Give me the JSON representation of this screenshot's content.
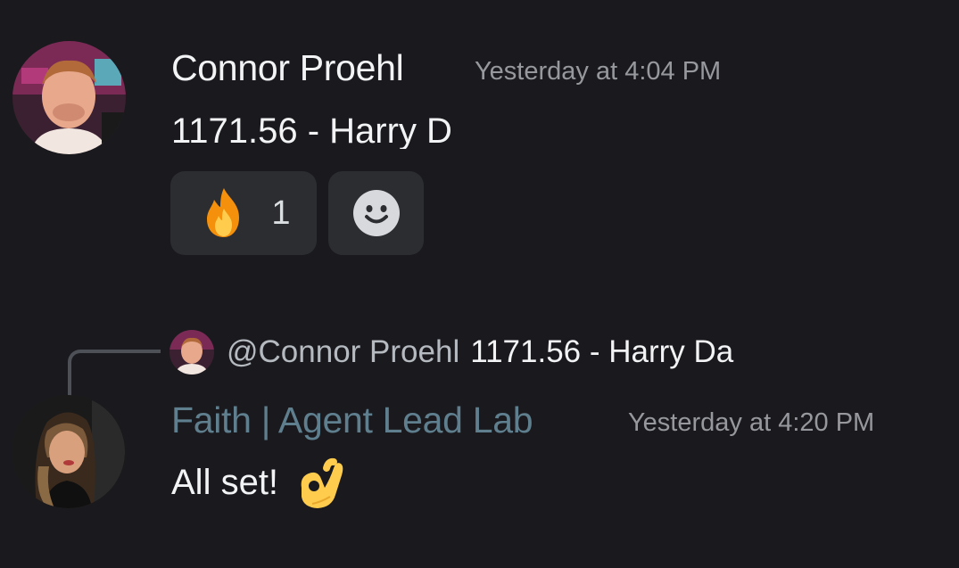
{
  "messages": [
    {
      "author": "Connor Proehl",
      "author_color": "#f2f3f5",
      "timestamp": "Yesterday at 4:04 PM",
      "content": "1171.56 - Harry D",
      "avatar": "avatar-photo-man",
      "reactions": [
        {
          "emoji": "fire-emoji",
          "count": "1"
        },
        {
          "emoji": "add-reaction-smiley-icon"
        }
      ]
    },
    {
      "reply_to": {
        "author": "@Connor Proehl",
        "content": "1171.56 - Harry Da",
        "avatar": "avatar-photo-man"
      },
      "author": "Faith | Agent Lead Lab",
      "author_color": "#5f7f8f",
      "timestamp": "Yesterday at 4:20 PM",
      "content": "All set!",
      "content_emoji": "ok-hand-emoji",
      "avatar": "avatar-photo-woman"
    }
  ]
}
